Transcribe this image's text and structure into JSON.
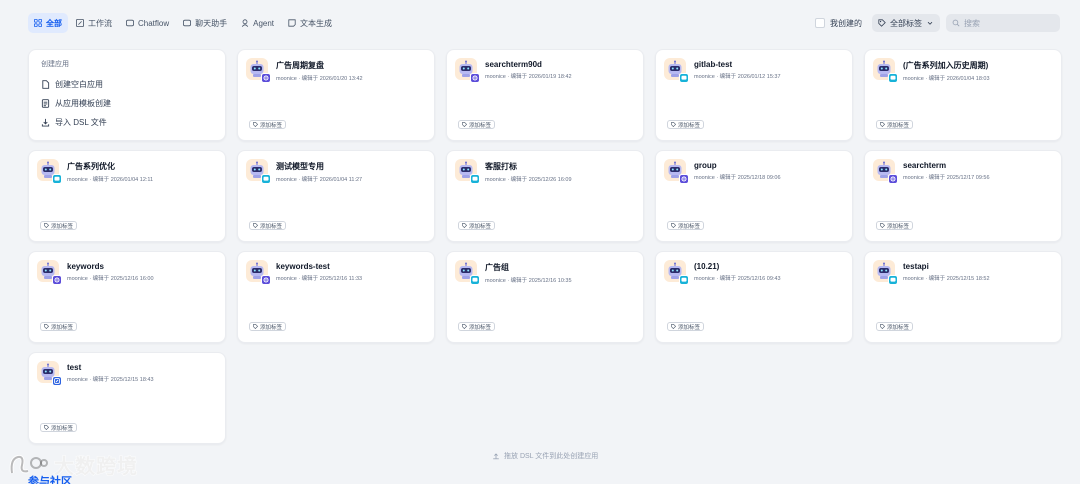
{
  "tabs": [
    {
      "label": "全部",
      "icon": "grid-icon",
      "active": true
    },
    {
      "label": "工作流",
      "icon": "workflow-icon",
      "active": false
    },
    {
      "label": "Chatflow",
      "icon": "chatflow-icon",
      "active": false
    },
    {
      "label": "聊天助手",
      "icon": "chat-icon",
      "active": false
    },
    {
      "label": "Agent",
      "icon": "agent-icon",
      "active": false
    },
    {
      "label": "文本生成",
      "icon": "text-icon",
      "active": false
    }
  ],
  "filters": {
    "mine_label": "我创建的",
    "tag_label": "全部标签",
    "search_placeholder": "搜索"
  },
  "create": {
    "title": "创建应用",
    "blank": "创建空白应用",
    "template": "从应用模板创建",
    "import": "导入 DSL 文件"
  },
  "add_tag_label": "添加标签",
  "apps": [
    {
      "name": "广告周期复盘",
      "meta": "moonice · 编辑于 2026/01/20 13:42",
      "badge": "agent"
    },
    {
      "name": "searchterm90d",
      "meta": "moonice · 编辑于 2026/01/19 18:42",
      "badge": "agent"
    },
    {
      "name": "gitlab-test",
      "meta": "moonice · 编辑于 2026/01/12 15:37",
      "badge": "chat"
    },
    {
      "name": "(广告系列加入历史周期)",
      "meta": "moonice · 编辑于 2026/01/04 18:03",
      "badge": "chat"
    },
    {
      "name": "广告系列优化",
      "meta": "moonice · 编辑于 2026/01/04 12:11",
      "badge": "chat"
    },
    {
      "name": "测试模型专用",
      "meta": "moonice · 编辑于 2026/01/04 11:27",
      "badge": "chat"
    },
    {
      "name": "客服打标",
      "meta": "moonice · 编辑于 2025/12/26 16:09",
      "badge": "chat"
    },
    {
      "name": "group",
      "meta": "moonice · 编辑于 2025/12/18 09:06",
      "badge": "agent"
    },
    {
      "name": "searchterm",
      "meta": "moonice · 编辑于 2025/12/17 09:56",
      "badge": "agent"
    },
    {
      "name": "keywords",
      "meta": "moonice · 编辑于 2025/12/16 16:00",
      "badge": "agent"
    },
    {
      "name": "keywords-test",
      "meta": "moonice · 编辑于 2025/12/16 11:33",
      "badge": "agent"
    },
    {
      "name": "广告组",
      "meta": "moonice · 编辑于 2025/12/16 10:35",
      "badge": "chat"
    },
    {
      "name": "(10.21)",
      "meta": "moonice · 编辑于 2025/12/16 09:43",
      "badge": "chat"
    },
    {
      "name": "testapi",
      "meta": "moonice · 编辑于 2025/12/15 18:52",
      "badge": "chat"
    },
    {
      "name": "test",
      "meta": "moonice · 编辑于 2025/12/15 18:43",
      "badge": "flow"
    }
  ],
  "drop_hint": "拖放 DSL 文件到此处创建应用",
  "watermark": "大数跨境",
  "community_label": "参与社区",
  "colors": {
    "accent": "#155eef",
    "chat_badge": "#17b2d8",
    "agent_badge": "#5b4cd9",
    "flow_badge": "#2e63e0",
    "avatar_bg": "#fdebd7"
  }
}
